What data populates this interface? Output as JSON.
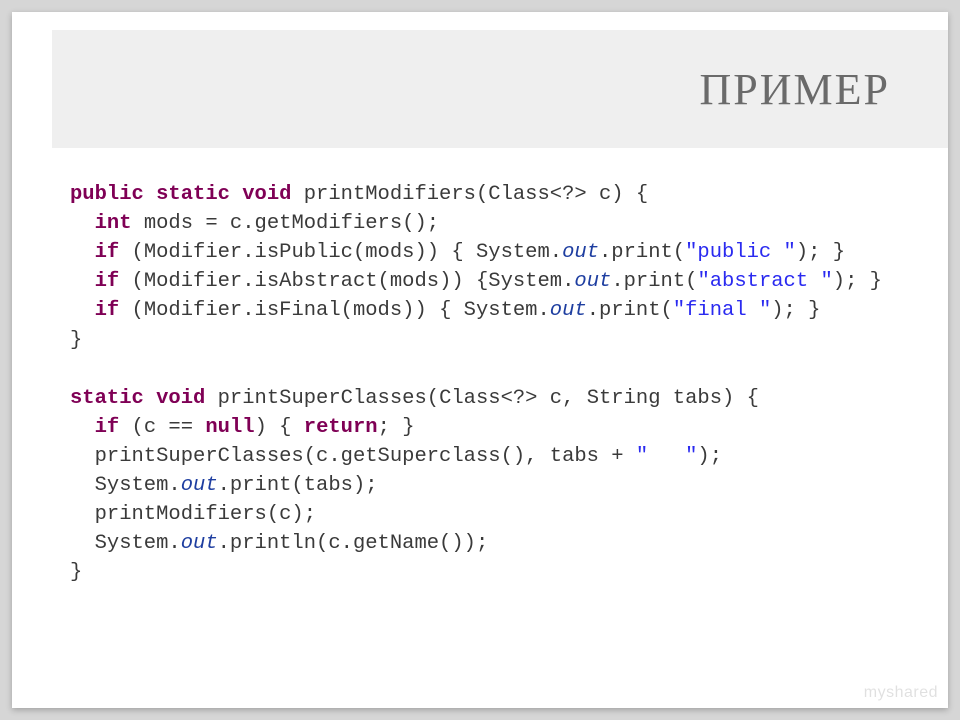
{
  "title": "ПРИМЕР",
  "watermark": "myshared",
  "code": {
    "l1": {
      "a": "public static void",
      "b": " printModifiers(Class<?> c) {"
    },
    "l2": {
      "a": "  ",
      "b": "int",
      "c": " mods = c.getModifiers();"
    },
    "l3": {
      "a": "  ",
      "b": "if",
      "c": " (Modifier.isPublic(mods)) { System.",
      "d": "out",
      "e": ".print(",
      "f": "\"public \"",
      "g": "); }"
    },
    "l4": {
      "a": "  ",
      "b": "if",
      "c": " (Modifier.isAbstract(mods)) {System.",
      "d": "out",
      "e": ".print(",
      "f": "\"abstract \"",
      "g": "); }"
    },
    "l5": {
      "a": "  ",
      "b": "if",
      "c": " (Modifier.isFinal(mods)) { System.",
      "d": "out",
      "e": ".print(",
      "f": "\"final \"",
      "g": "); }"
    },
    "l6": {
      "a": "}"
    },
    "l7": {
      "a": ""
    },
    "l8": {
      "a": "static void",
      "b": " printSuperClasses(Class<?> c, String tabs) {"
    },
    "l9": {
      "a": "  ",
      "b": "if",
      "c": " (c == ",
      "d": "null",
      "e": ") { ",
      "f": "return",
      "g": "; }"
    },
    "l10": {
      "a": "  printSuperClasses(c.getSuperclass(), tabs + ",
      "b": "\"   \"",
      "c": ");"
    },
    "l11": {
      "a": "  System.",
      "b": "out",
      "c": ".print(tabs);"
    },
    "l12": {
      "a": "  printModifiers(c);"
    },
    "l13": {
      "a": "  System.",
      "b": "out",
      "c": ".println(c.getName());"
    },
    "l14": {
      "a": "}"
    }
  }
}
